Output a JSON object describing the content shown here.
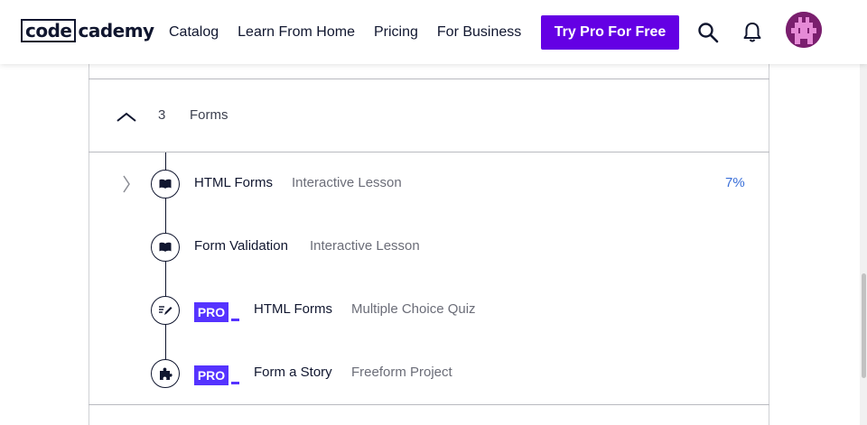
{
  "header": {
    "logo_left": "code",
    "logo_right": "cademy",
    "nav": [
      "Catalog",
      "Learn From Home",
      "Pricing",
      "For Business"
    ],
    "cta": "Try Pro For Free"
  },
  "module": {
    "number": "3",
    "title": "Forms"
  },
  "lessons": [
    {
      "title": "HTML Forms",
      "type": "Interactive Lesson",
      "progress": "7%",
      "pro": false,
      "icon": "book-icon"
    },
    {
      "title": "Form Validation",
      "type": "Interactive Lesson",
      "pro": false,
      "icon": "book-icon"
    },
    {
      "title": "HTML Forms",
      "type": "Multiple Choice Quiz",
      "pro": true,
      "pro_label": "PRO",
      "icon": "quiz-icon"
    },
    {
      "title": "Form a Story",
      "type": "Freeform Project",
      "pro": true,
      "pro_label": "PRO",
      "icon": "puzzle-icon"
    }
  ],
  "colors": {
    "brand_purple": "#6400e4",
    "pro_blue": "#5533ff",
    "progress_blue": "#3a6fd8",
    "navy": "#10162f"
  }
}
